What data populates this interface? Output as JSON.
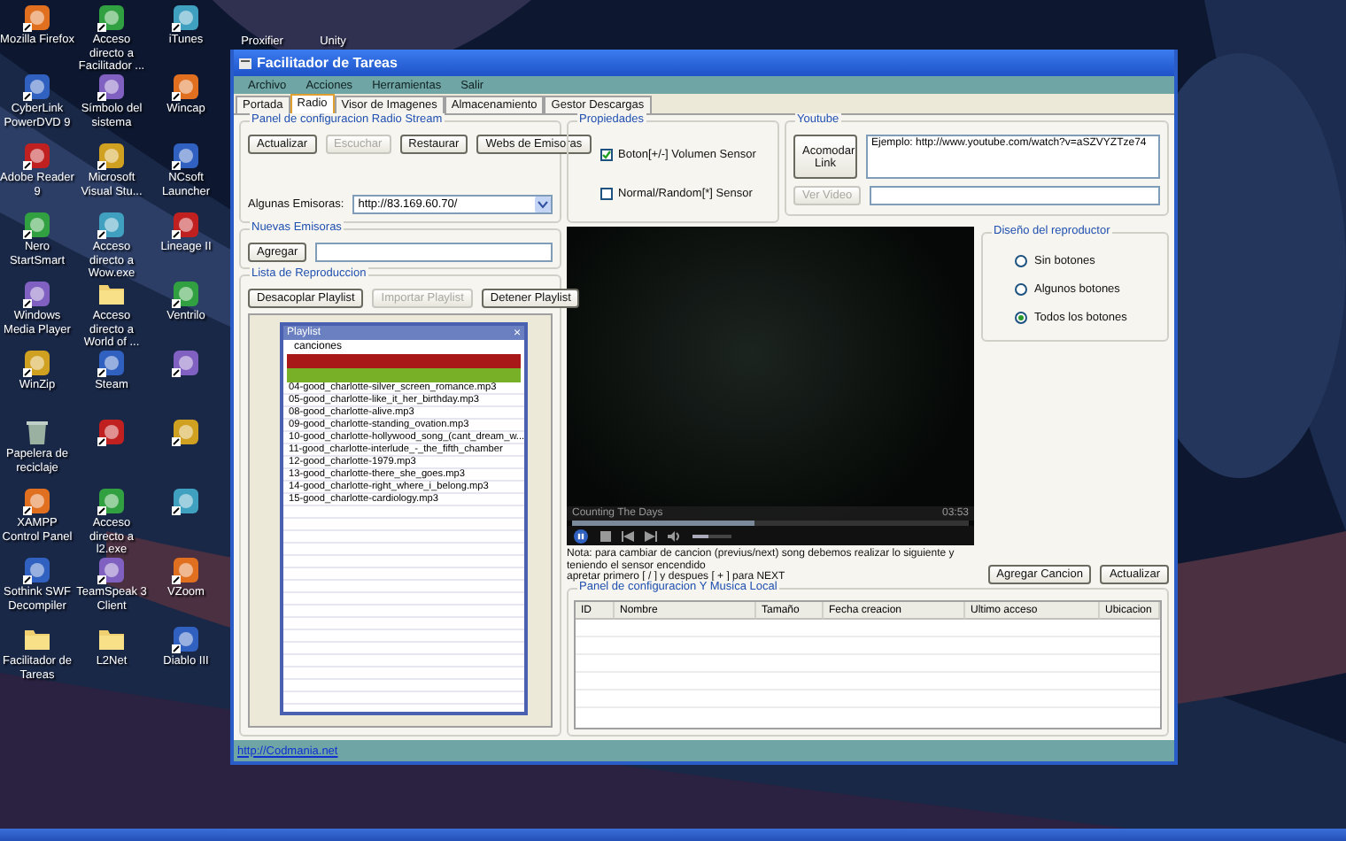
{
  "desktop": {
    "icons": [
      {
        "label": "Mozilla Firefox",
        "kind": "app"
      },
      {
        "label": "CyberLink PowerDVD 9",
        "kind": "app"
      },
      {
        "label": "Adobe Reader 9",
        "kind": "app"
      },
      {
        "label": "Nero StartSmart",
        "kind": "app"
      },
      {
        "label": "Windows Media Player",
        "kind": "app"
      },
      {
        "label": "WinZip",
        "kind": "app"
      },
      {
        "label": "Papelera de reciclaje",
        "kind": "bin"
      },
      {
        "label": "XAMPP Control Panel",
        "kind": "app"
      },
      {
        "label": "Sothink SWF Decompiler",
        "kind": "app"
      },
      {
        "label": "Facilitador de Tareas",
        "kind": "folder"
      },
      {
        "label": "Acceso directo a Facilitador ...",
        "kind": "app"
      },
      {
        "label": "Símbolo del sistema",
        "kind": "app"
      },
      {
        "label": "Microsoft Visual Stu...",
        "kind": "app"
      },
      {
        "label": "Acceso directo a Wow.exe",
        "kind": "app"
      },
      {
        "label": "Acceso directo a World of ...",
        "kind": "folder"
      },
      {
        "label": "Steam",
        "kind": "app"
      },
      {
        "kind": "app"
      },
      {
        "label": "Acceso directo a l2.exe",
        "kind": "app"
      },
      {
        "label": "TeamSpeak 3 Client",
        "kind": "app"
      },
      {
        "label": "L2Net",
        "kind": "folder"
      },
      {
        "label": "iTunes",
        "kind": "app"
      },
      {
        "label": "Wincap",
        "kind": "app"
      },
      {
        "label": "NCsoft Launcher",
        "kind": "app"
      },
      {
        "label": "Lineage II",
        "kind": "app"
      },
      {
        "label": "Ventrilo",
        "kind": "app"
      },
      {
        "kind": "app"
      },
      {
        "kind": "app"
      },
      {
        "kind": "app"
      },
      {
        "label": "VZoom",
        "kind": "app"
      },
      {
        "label": "Diablo III",
        "kind": "app"
      }
    ],
    "top_icons": [
      {
        "label": "Proxifier"
      },
      {
        "label": "Unity"
      }
    ]
  },
  "window": {
    "title": "Facilitador de Tareas",
    "menu": [
      "Archivo",
      "Acciones",
      "Herramientas",
      "Salir"
    ],
    "tabs": [
      {
        "label": "Portada",
        "selected": false
      },
      {
        "label": "Radio",
        "selected": true
      },
      {
        "label": "Visor de Imagenes",
        "selected": false
      },
      {
        "label": "Almacenamiento",
        "selected": false
      },
      {
        "label": "Gestor Descargas",
        "selected": false
      }
    ],
    "radio_stream": {
      "title": "Panel de configuracion Radio Stream",
      "buttons": [
        {
          "label": "Actualizar",
          "disabled": false
        },
        {
          "label": "Escuchar",
          "disabled": true
        },
        {
          "label": "Restaurar",
          "disabled": false
        },
        {
          "label": "Webs de Emisoras",
          "disabled": false
        }
      ],
      "stations_label": "Algunas Emisoras:",
      "stations_value": "http://83.169.60.70/"
    },
    "new_stations": {
      "title": "Nuevas Emisoras",
      "button": "Agregar"
    },
    "playlist": {
      "title": "Lista de Reproduccion",
      "buttons": [
        {
          "label": "Desacoplar Playlist",
          "disabled": false
        },
        {
          "label": "Importar Playlist",
          "disabled": true
        },
        {
          "label": "Detener Playlist",
          "disabled": false
        }
      ],
      "window_title": "Playlist",
      "close": "×",
      "header": "canciones",
      "highlights": [
        {
          "color": "#a81818"
        },
        {
          "color": "#78b028"
        }
      ],
      "songs": [
        "04-good_charlotte-silver_screen_romance.mp3",
        "05-good_charlotte-like_it_her_birthday.mp3",
        "08-good_charlotte-alive.mp3",
        "09-good_charlotte-standing_ovation.mp3",
        "10-good_charlotte-hollywood_song_(cant_dream_w...",
        "11-good_charlotte-interlude_-_the_fifth_chamber",
        "12-good_charlotte-1979.mp3",
        "13-good_charlotte-there_she_goes.mp3",
        "14-good_charlotte-right_where_i_belong.mp3",
        "15-good_charlotte-cardiology.mp3"
      ]
    },
    "properties": {
      "title": "Propiedades",
      "checks": [
        {
          "label": "Boton[+/-] Volumen Sensor",
          "checked": true
        },
        {
          "label": "Normal/Random[*] Sensor",
          "checked": false
        }
      ]
    },
    "youtube": {
      "title": "Youtube",
      "fit_button": "Acomodar Link",
      "example": "Ejemplo: http://www.youtube.com/watch?v=aSZVYZTze74",
      "view_button": "Ver Video",
      "view_disabled": true
    },
    "player": {
      "song": "Counting The Days",
      "time": "03:53",
      "seek": {
        "level": 0.46
      },
      "volume": {
        "level": 0.4
      }
    },
    "design": {
      "title": "Diseño del reproductor",
      "options": [
        {
          "label": "Sin botones",
          "selected": false
        },
        {
          "label": "Algunos botones",
          "selected": false
        },
        {
          "label": "Todos los botones",
          "selected": true
        }
      ]
    },
    "note": "Nota:  para cambiar de cancion (previus/next) song debemos realizar lo siguiente y teniendo el sensor encendido\napretar primero [ / ] y despues [ + ] para NEXT",
    "song_buttons": [
      "Agregar Cancion",
      "Actualizar"
    ],
    "local_music": {
      "title": "Panel de configuracion Y Musica Local",
      "columns": [
        "ID",
        "Nombre",
        "Tamaño",
        "Fecha creacion",
        "Ultimo acceso",
        "Ubicacion"
      ]
    },
    "status_link": "http://Codmania.net"
  }
}
